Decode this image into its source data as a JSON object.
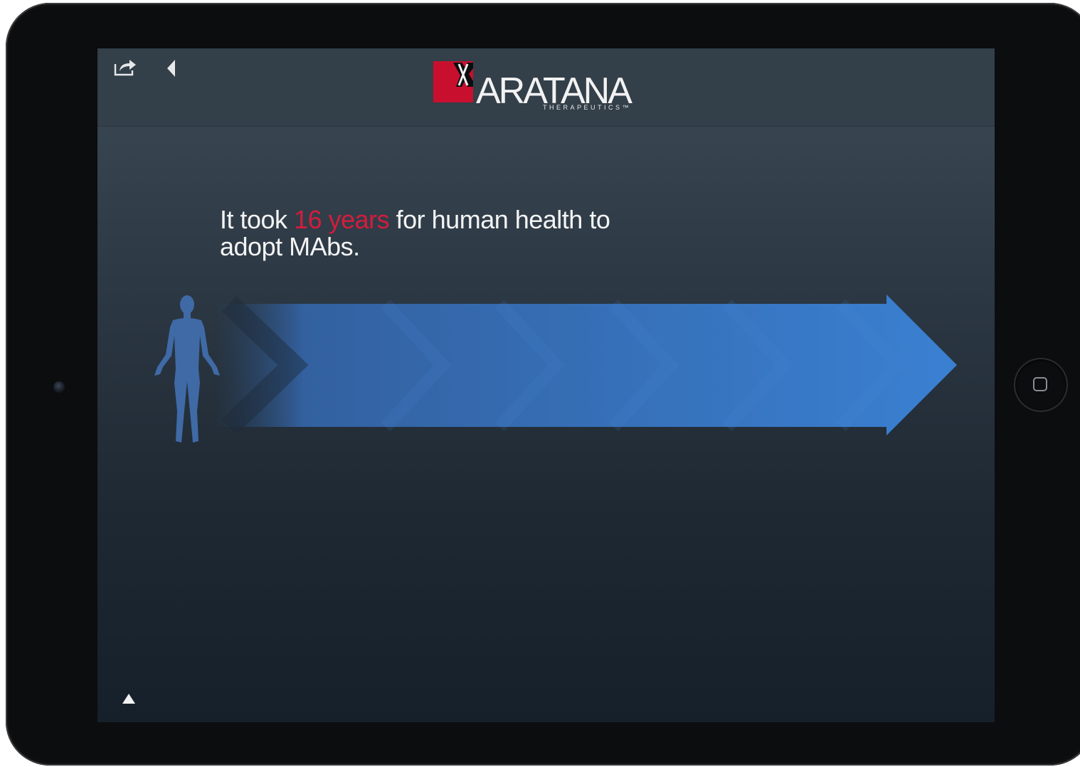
{
  "device": {
    "type": "tablet-landscape"
  },
  "toolbar": {
    "share_icon": "share-icon",
    "back_icon": "chevron-left-icon"
  },
  "logo": {
    "name": "ARATANA",
    "subtitle": "THERAPEUTICS™",
    "brand_color": "#c8102e"
  },
  "slide": {
    "headline_part1": "It took ",
    "headline_highlight": "16 years",
    "headline_part2": " for human health to adopt MAbs.",
    "highlight_color": "#d41c3c",
    "arrow_color": "#3a7fd0",
    "figure_icon": "human-figure-icon"
  },
  "footer": {
    "up_icon": "triangle-up-icon"
  }
}
